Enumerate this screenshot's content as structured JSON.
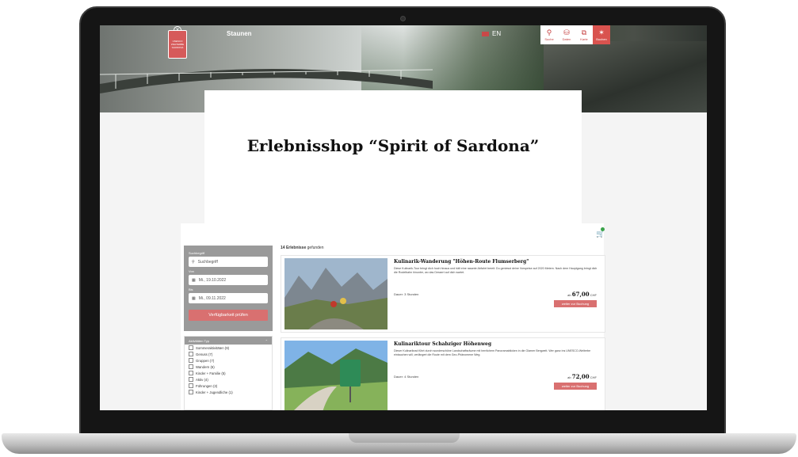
{
  "header": {
    "nav_title": "Staunen",
    "lang": "EN",
    "logo_text": [
      "UNESCO",
      "WELTERBE",
      "SARDONA"
    ],
    "tools": [
      {
        "label": "Suche",
        "icon": "search-icon"
      },
      {
        "label": "Daten",
        "icon": "database-icon"
      },
      {
        "label": "Karte",
        "icon": "map-icon"
      },
      {
        "label": "Buchen",
        "icon": "book-icon"
      }
    ]
  },
  "main": {
    "title": "Erlebnisshop “Spirit of Sardona”"
  },
  "filter": {
    "search_label": "Suchbegriff",
    "search_placeholder": "Suchbegriff",
    "from_label": "Von",
    "from_value": "Mi., 19.10.2022",
    "to_label": "Bis",
    "to_value": "Mi., 09.11.2022",
    "check_button": "Verfügbarkeit prüfen",
    "types_title": "Aktivitäten Typ",
    "types": [
      "Sommeraktivitäten (9)",
      "Genuss (7)",
      "Gruppen (7)",
      "Wandern (6)",
      "Kinder + Familie (5)",
      "Aktiv (4)",
      "Führungen (3)",
      "Kinder + Jugendliche (1)"
    ]
  },
  "results": {
    "count": "14 Erlebnisse",
    "suffix": "gefunden",
    "items": [
      {
        "title": "Kulinarik-Wanderung \"Höhen-Route Flumserberg\"",
        "desc": "Diese Kulinarik-Tour bringt dich hoch hinaus und hält eine rasante Abfahrt bereit: Du geniesst deine Vorspeise auf 2020 Metern. Nach dem Hauptgang bringt dich die Rodelbahn hinunter, wo das Dessert auf dich wartet.",
        "duration": "Dauer: 3 Stunden",
        "price_prefix": "ab",
        "price": "67,00",
        "currency": "CHF",
        "button": "weiter zur Buchung"
      },
      {
        "title": "Kulinariktour Schabziger Höhenweg",
        "desc": "Dieser Kulinarikrad führt durch wunderschöne Landschaftsräume mit herrlichem Panoramablicken in die Glarner Bergwelt. Wer ganz ins UNESCO-Welterbe eintauchen will, verlängert die Route mit dem Geo-Phänomene Weg.",
        "duration": "Dauer: 4 Stunden",
        "price_prefix": "ab",
        "price": "72,00",
        "currency": "CHF",
        "button": "weiter zur Buchung"
      }
    ]
  },
  "colors": {
    "accent": "#d97070",
    "filter_bg": "#9a9a9a",
    "brand_red": "#c53e3e"
  }
}
